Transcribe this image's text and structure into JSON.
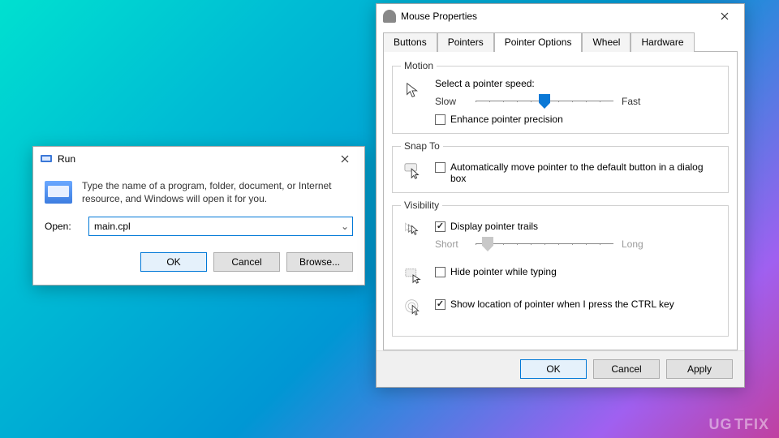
{
  "run": {
    "title": "Run",
    "description": "Type the name of a program, folder, document, or Internet resource, and Windows will open it for you.",
    "open_label": "Open:",
    "open_value": "main.cpl",
    "buttons": {
      "ok": "OK",
      "cancel": "Cancel",
      "browse": "Browse..."
    }
  },
  "mouse": {
    "title": "Mouse Properties",
    "tabs": [
      "Buttons",
      "Pointers",
      "Pointer Options",
      "Wheel",
      "Hardware"
    ],
    "active_tab": "Pointer Options",
    "motion": {
      "legend": "Motion",
      "select_label": "Select a pointer speed:",
      "slow": "Slow",
      "fast": "Fast",
      "enhance": {
        "label": "Enhance pointer precision",
        "checked": false
      }
    },
    "snapto": {
      "legend": "Snap To",
      "auto": {
        "label": "Automatically move pointer to the default button in a dialog box",
        "checked": false
      }
    },
    "visibility": {
      "legend": "Visibility",
      "trails": {
        "label": "Display pointer trails",
        "checked": true
      },
      "short": "Short",
      "long": "Long",
      "hide": {
        "label": "Hide pointer while typing",
        "checked": false
      },
      "showloc": {
        "label": "Show location of pointer when I press the CTRL key",
        "checked": true
      }
    },
    "buttons": {
      "ok": "OK",
      "cancel": "Cancel",
      "apply": "Apply"
    }
  },
  "watermark": "UG TFIX"
}
